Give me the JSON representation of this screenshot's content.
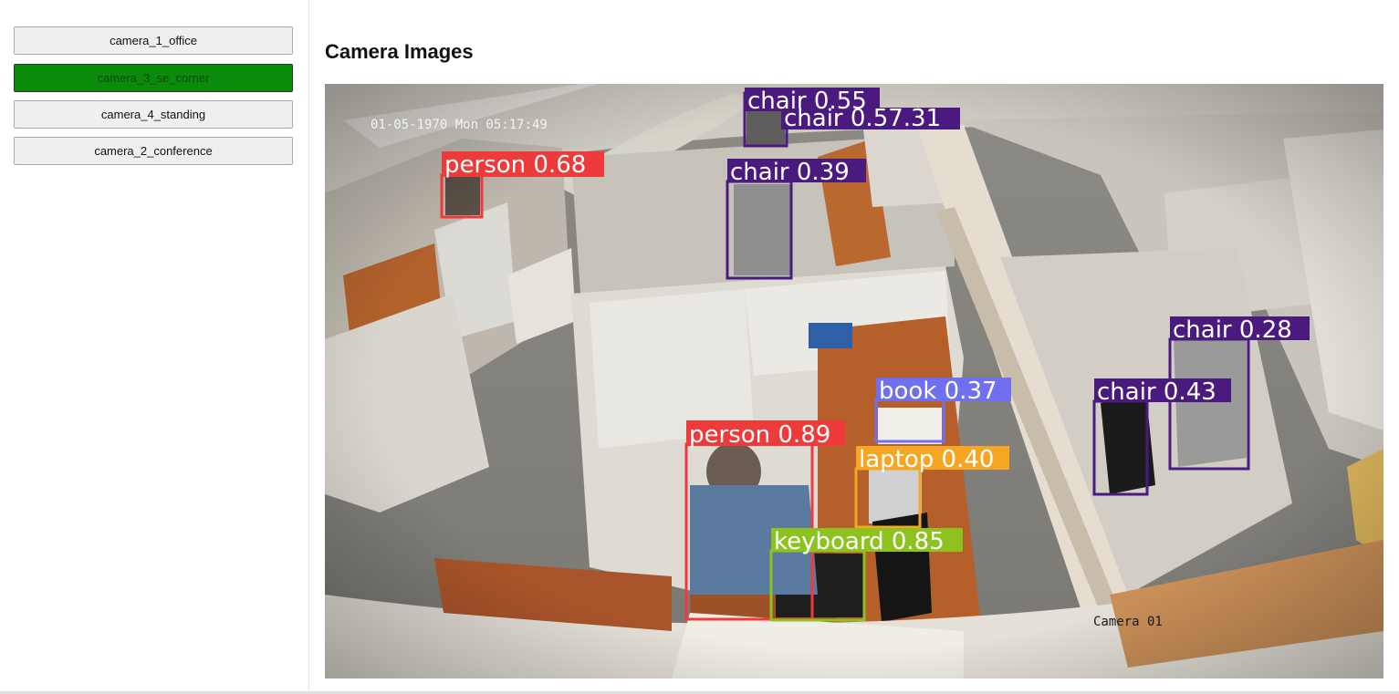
{
  "sidebar": {
    "cameras": [
      {
        "label": "camera_1_office",
        "active": false
      },
      {
        "label": "camera_3_se_corner",
        "active": true
      },
      {
        "label": "camera_4_standing",
        "active": false
      },
      {
        "label": "camera_2_conference",
        "active": false
      }
    ],
    "active_color": "#0b8a0b"
  },
  "main": {
    "title": "Camera Images",
    "image": {
      "timestamp": "01-05-1970 Mon 05:17:49",
      "camera_name": "Camera 01",
      "detections": [
        {
          "label": "chair 0.55",
          "color": "#4b1a7f"
        },
        {
          "label": "chair 0.57.31",
          "color": "#4b1a7f"
        },
        {
          "label": "person 0.68",
          "color": "#ee3a3a"
        },
        {
          "label": "chair 0.39",
          "color": "#4b1a7f"
        },
        {
          "label": "chair 0.28",
          "color": "#4b1a7f"
        },
        {
          "label": "book 0.37",
          "color": "#6f6ff0"
        },
        {
          "label": "chair 0.43",
          "color": "#4b1a7f"
        },
        {
          "label": "person 0.89",
          "color": "#ee3a3a"
        },
        {
          "label": "laptop 0.40",
          "color": "#f5a623"
        },
        {
          "label": "keyboard 0.85",
          "color": "#8dc21f"
        }
      ]
    }
  }
}
